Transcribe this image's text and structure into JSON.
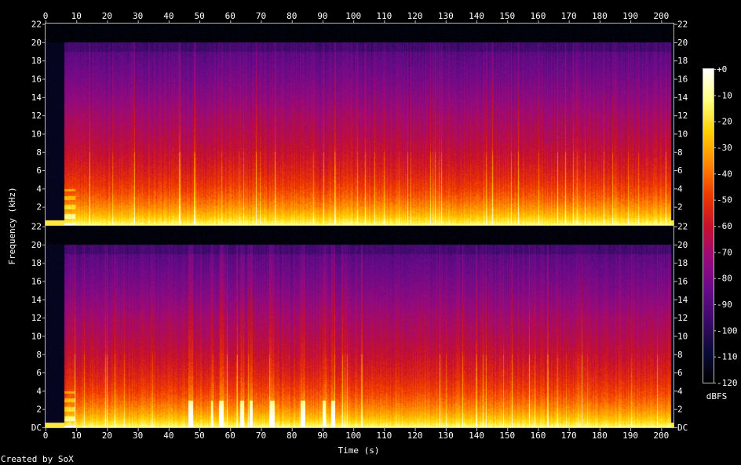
{
  "footer": {
    "credit": "Created by SoX"
  },
  "colors": {
    "background": "#000000",
    "frame": "#ffffff",
    "palette": [
      "#000000",
      "#0a0a3a",
      "#3c0a6a",
      "#6a0a8a",
      "#9a0a7a",
      "#c8102a",
      "#f03a00",
      "#ff8a00",
      "#ffd000",
      "#ffff80",
      "#ffffff"
    ]
  },
  "chart_data": {
    "type": "heatmap",
    "title": "",
    "xlabel": "Time (s)",
    "ylabel": "Frequency (kHz)",
    "xlim": [
      0,
      204
    ],
    "x_ticks": [
      "0",
      "10",
      "20",
      "30",
      "40",
      "50",
      "60",
      "70",
      "80",
      "90",
      "100",
      "110",
      "120",
      "130",
      "140",
      "150",
      "160",
      "170",
      "180",
      "190",
      "200"
    ],
    "channels": [
      {
        "name": "",
        "ylim": [
          0,
          22.05
        ],
        "y_ticks": [
          "2",
          "4",
          "6",
          "8",
          "10",
          "12",
          "14",
          "16",
          "18",
          "20",
          "22"
        ]
      },
      {
        "name": "",
        "ylim": [
          0,
          22.05
        ],
        "y_ticks": [
          "DC",
          "2",
          "4",
          "6",
          "8",
          "10",
          "12",
          "14",
          "16",
          "18",
          "20",
          "22"
        ]
      }
    ],
    "colorbar": {
      "label": "dBFS",
      "range": [
        -120,
        0
      ],
      "ticks": [
        "+0",
        "-10",
        "-20",
        "-30",
        "-40",
        "-50",
        "-60",
        "-70",
        "-80",
        "-90",
        "-100",
        "-110",
        "-120"
      ]
    },
    "content_cutoff_khz": 20,
    "audio_start_s": 6,
    "audio_end_s": 203
  }
}
